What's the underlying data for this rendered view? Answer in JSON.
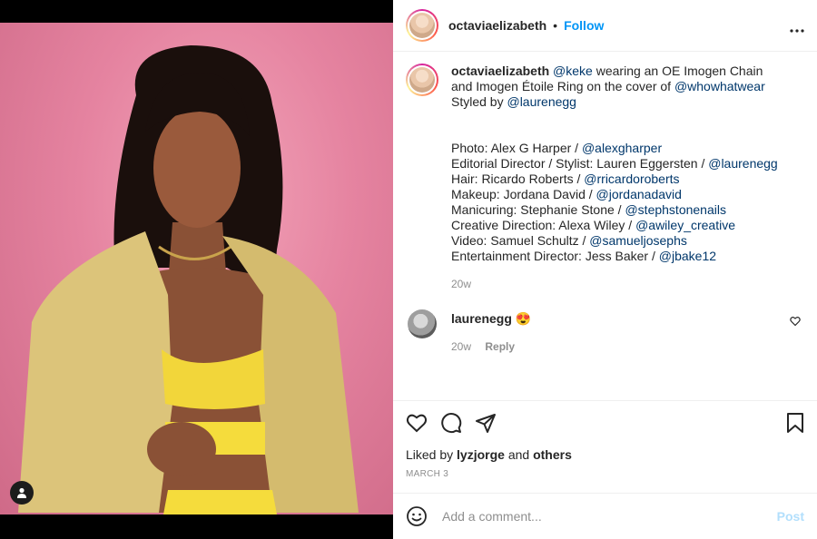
{
  "post": {
    "author": "octaviaelizabeth",
    "follow_label": "Follow",
    "separator": "•",
    "more_label": "•••"
  },
  "caption": {
    "author": "octaviaelizabeth",
    "mention_keke": "@keke",
    "text_1": " wearing an OE Imogen Chain and Imogen Étoile Ring on the cover of ",
    "mention_wwh": "@whowhatwear",
    "text_2": " Styled by ",
    "mention_lauren": "@laurenegg",
    "credits": [
      {
        "label": "Photo: Alex G Harper / ",
        "handle": "@alexgharper"
      },
      {
        "label": "Editorial Director / Stylist: Lauren Eggersten / ",
        "handle": "@laurenegg"
      },
      {
        "label": "Hair: Ricardo Roberts / ",
        "handle": "@rricardoroberts"
      },
      {
        "label": "Makeup: Jordana David / ",
        "handle": "@jordanadavid"
      },
      {
        "label": "Manicuring: Stephanie Stone / ",
        "handle": "@stephstonenails"
      },
      {
        "label": "Creative Direction: Alexa Wiley / ",
        "handle": "@awiley_creative"
      },
      {
        "label": "Video: Samuel Schultz / ",
        "handle": "@samueljosephs"
      },
      {
        "label": "Entertainment Director: Jess Baker / ",
        "handle": "@jbake12"
      }
    ],
    "time": "20w"
  },
  "comment": {
    "author": "laurenegg",
    "text": "😍",
    "time": "20w",
    "reply_label": "Reply"
  },
  "likes": {
    "prefix": "Liked by ",
    "user": "lyzjorge",
    "middle": " and ",
    "others": "others"
  },
  "date": "MARCH 3",
  "add_comment": {
    "placeholder": "Add a comment...",
    "post_label": "Post"
  },
  "colors": {
    "accent": "#0095f6",
    "link": "#00376b",
    "muted": "#8e8e8e",
    "post_disabled": "#b2dffc",
    "photo_bg": "#e583a0"
  },
  "icons": [
    "user-tag-icon",
    "more-options-icon",
    "heart-icon",
    "comment-icon",
    "share-icon",
    "bookmark-icon",
    "emoji-icon",
    "comment-heart-icon"
  ]
}
